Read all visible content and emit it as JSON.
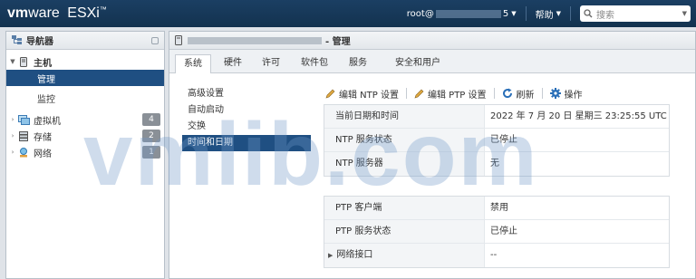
{
  "topbar": {
    "brand_vm": "vm",
    "brand_ware": "ware",
    "product": "ESXi",
    "user_prefix": "root@",
    "user_suffix": "5",
    "help": "帮助",
    "search_placeholder": "搜索"
  },
  "navigator": {
    "title": "导航器",
    "host_label": "主机",
    "items": [
      {
        "label": "管理",
        "selected": true
      },
      {
        "label": "监控",
        "selected": false
      }
    ],
    "groups": [
      {
        "label": "虚拟机",
        "count": "4",
        "icon": "vm-icon"
      },
      {
        "label": "存储",
        "count": "2",
        "icon": "storage-icon"
      },
      {
        "label": "网络",
        "count": "1",
        "icon": "network-icon"
      }
    ]
  },
  "main": {
    "title_suffix": "- 管理",
    "tabs": [
      "系统",
      "硬件",
      "许可",
      "软件包",
      "服务",
      "安全和用户"
    ],
    "active_tab": "系统",
    "subnav": [
      {
        "label": "高级设置",
        "selected": false
      },
      {
        "label": "自动启动",
        "selected": false
      },
      {
        "label": "交换",
        "selected": false
      },
      {
        "label": "时间和日期",
        "selected": true
      }
    ],
    "toolbar": {
      "edit_ntp": "编辑 NTP 设置",
      "edit_ptp": "编辑 PTP 设置",
      "refresh": "刷新",
      "actions": "操作"
    },
    "ntp_table": [
      {
        "key": "当前日期和时间",
        "value": "2022 年 7 月 20 日 星期三 23:25:55 UTC"
      },
      {
        "key": "NTP 服务状态",
        "value": "已停止"
      },
      {
        "key": "NTP 服务器",
        "value": "无"
      }
    ],
    "ptp_table": [
      {
        "key": "PTP 客户端",
        "value": "禁用"
      },
      {
        "key": "PTP 服务状态",
        "value": "已停止"
      },
      {
        "key": "网络接口",
        "value": "--"
      }
    ]
  },
  "watermark": "vmlib.com",
  "colors": {
    "topbar": "#16375a",
    "selection": "#1f4f82",
    "badge": "#8a9097"
  }
}
